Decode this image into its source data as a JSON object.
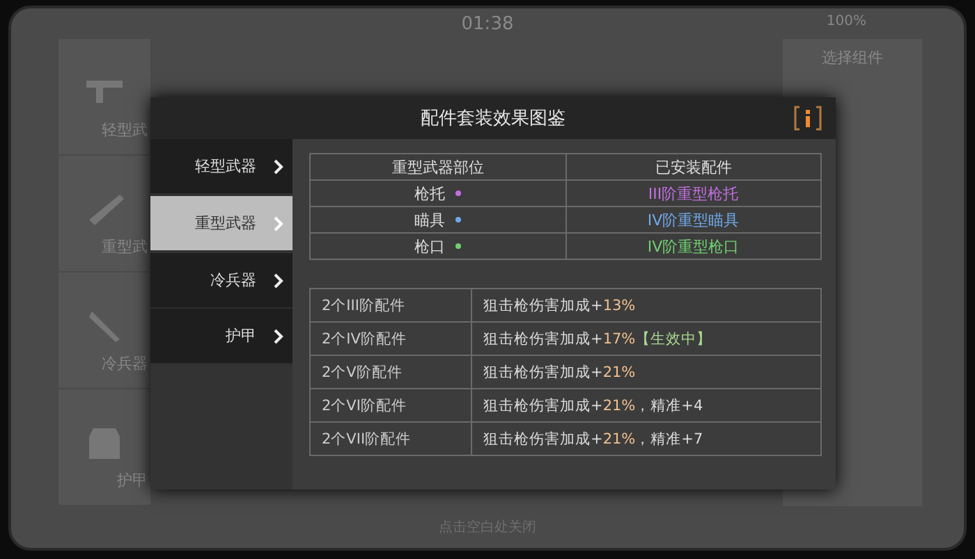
{
  "status_bar": {
    "time": "01:38",
    "battery": "100%"
  },
  "background": {
    "panel_title": "选择组件",
    "sidebar": [
      {
        "label": "轻型武"
      },
      {
        "label": "重型武"
      },
      {
        "label": "冷兵器"
      },
      {
        "label": "护甲"
      }
    ],
    "hint": "点击空白处关闭"
  },
  "dialog": {
    "title": "配件套装效果图鉴",
    "tabs": [
      {
        "label": "轻型武器",
        "selected": false
      },
      {
        "label": "重型武器",
        "selected": true
      },
      {
        "label": "冷兵器",
        "selected": false
      },
      {
        "label": "护甲",
        "selected": false
      }
    ],
    "parts_table": {
      "columns": [
        "重型武器部位",
        "已安装配件"
      ],
      "rows": [
        {
          "part": "枪托",
          "color": "#c070e0",
          "installed": "III阶重型枪托"
        },
        {
          "part": "瞄具",
          "color": "#70a8e8",
          "installed": "IV阶重型瞄具"
        },
        {
          "part": "枪口",
          "color": "#70d070",
          "installed": "IV阶重型枪口"
        }
      ]
    },
    "effects": [
      {
        "requirement": "2个III阶配件",
        "effect": "狙击枪伤害加成+",
        "value": "13%"
      },
      {
        "requirement": "2个IV阶配件",
        "effect": "狙击枪伤害加成+",
        "value": "17%",
        "status": "【生效中】"
      },
      {
        "requirement": "2个V阶配件",
        "effect": "狙击枪伤害加成+",
        "value": "21%"
      },
      {
        "requirement": "2个VI阶配件",
        "effect": "狙击枪伤害加成+",
        "value": "21%",
        "extra": "，精准+4"
      },
      {
        "requirement": "2个VII阶配件",
        "effect": "狙击枪伤害加成+",
        "value": "21%",
        "extra": "，精准+7"
      }
    ]
  }
}
